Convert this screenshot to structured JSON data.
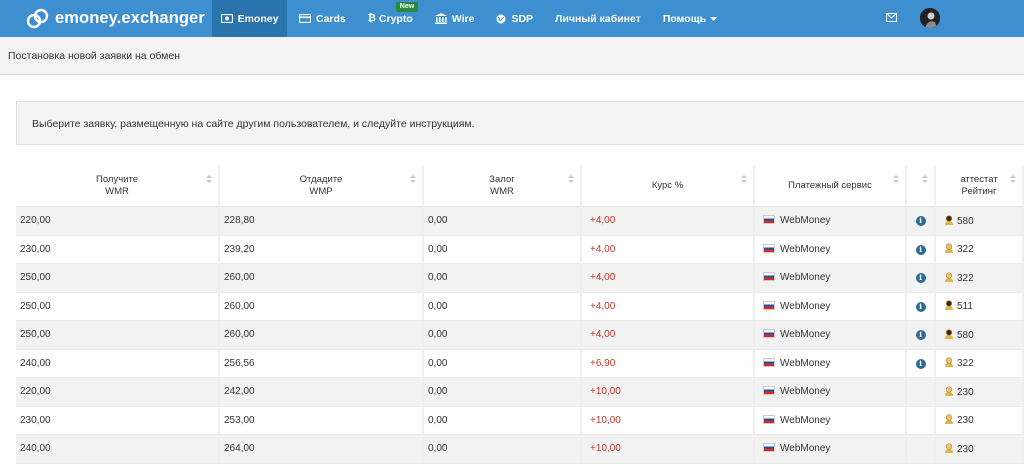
{
  "brand": {
    "name": "emoney.exchanger",
    "logo_icon": "link-chain-icon"
  },
  "nav": {
    "items": [
      {
        "label": "Emoney",
        "icon": "banknote-icon",
        "active": true
      },
      {
        "label": "Cards",
        "icon": "credit-card-icon"
      },
      {
        "label": "Crypto",
        "icon": "bitcoin-icon",
        "badge": "New"
      },
      {
        "label": "Wire",
        "icon": "bank-icon"
      },
      {
        "label": "SDP",
        "icon": "globe-icon"
      },
      {
        "label": "Личный кабинет"
      },
      {
        "label": "Помощь",
        "icon": "caret-down-icon"
      }
    ],
    "mail_icon": "envelope-icon",
    "avatar_icon": "user-avatar-icon"
  },
  "page": {
    "title": "Постановка новой заявки на обмен",
    "alert": "Выберите заявку, размещенную на сайте другим пользователем, и следуйте инструкциям."
  },
  "table": {
    "headers": [
      {
        "line1": "Получите",
        "line2": "WMR"
      },
      {
        "line1": "Отдадите",
        "line2": "WMP"
      },
      {
        "line1": "Залог",
        "line2": "WMR"
      },
      {
        "line1": "Курс %",
        "line2": ""
      },
      {
        "line1": "Платежный сервис",
        "line2": ""
      },
      {
        "line1": "",
        "line2": ""
      },
      {
        "line1": "аттестат",
        "line2": "Рейтинг"
      }
    ],
    "rows": [
      {
        "receive": "220,00",
        "give": "228,80",
        "deposit": "0,00",
        "rate": "+4,00",
        "service": "WebMoney",
        "info": true,
        "cert": "personal",
        "rating": "580"
      },
      {
        "receive": "230,00",
        "give": "239,20",
        "deposit": "0,00",
        "rate": "+4,00",
        "service": "WebMoney",
        "info": true,
        "cert": "formal",
        "rating": "322"
      },
      {
        "receive": "250,00",
        "give": "260,00",
        "deposit": "0,00",
        "rate": "+4,00",
        "service": "WebMoney",
        "info": true,
        "cert": "formal",
        "rating": "322"
      },
      {
        "receive": "250,00",
        "give": "260,00",
        "deposit": "0,00",
        "rate": "+4,00",
        "service": "WebMoney",
        "info": true,
        "cert": "personal",
        "rating": "511"
      },
      {
        "receive": "250,00",
        "give": "260,00",
        "deposit": "0,00",
        "rate": "+4,00",
        "service": "WebMoney",
        "info": true,
        "cert": "personal",
        "rating": "580"
      },
      {
        "receive": "240,00",
        "give": "256,56",
        "deposit": "0,00",
        "rate": "+6,90",
        "service": "WebMoney",
        "info": true,
        "cert": "formal",
        "rating": "322"
      },
      {
        "receive": "220,00",
        "give": "242,00",
        "deposit": "0,00",
        "rate": "+10,00",
        "service": "WebMoney",
        "info": false,
        "cert": "formal",
        "rating": "230"
      },
      {
        "receive": "230,00",
        "give": "253,00",
        "deposit": "0,00",
        "rate": "+10,00",
        "service": "WebMoney",
        "info": false,
        "cert": "formal",
        "rating": "230"
      },
      {
        "receive": "240,00",
        "give": "264,00",
        "deposit": "0,00",
        "rate": "+10,00",
        "service": "WebMoney",
        "info": false,
        "cert": "formal",
        "rating": "230"
      }
    ],
    "colors": {
      "rate_positive": "#c0392b",
      "info_icon": "#2c6c94"
    }
  },
  "colors": {
    "navbar": "#3d8fcf",
    "navbar_active": "#2a74ad",
    "badge_new": "#2a8a3c"
  }
}
